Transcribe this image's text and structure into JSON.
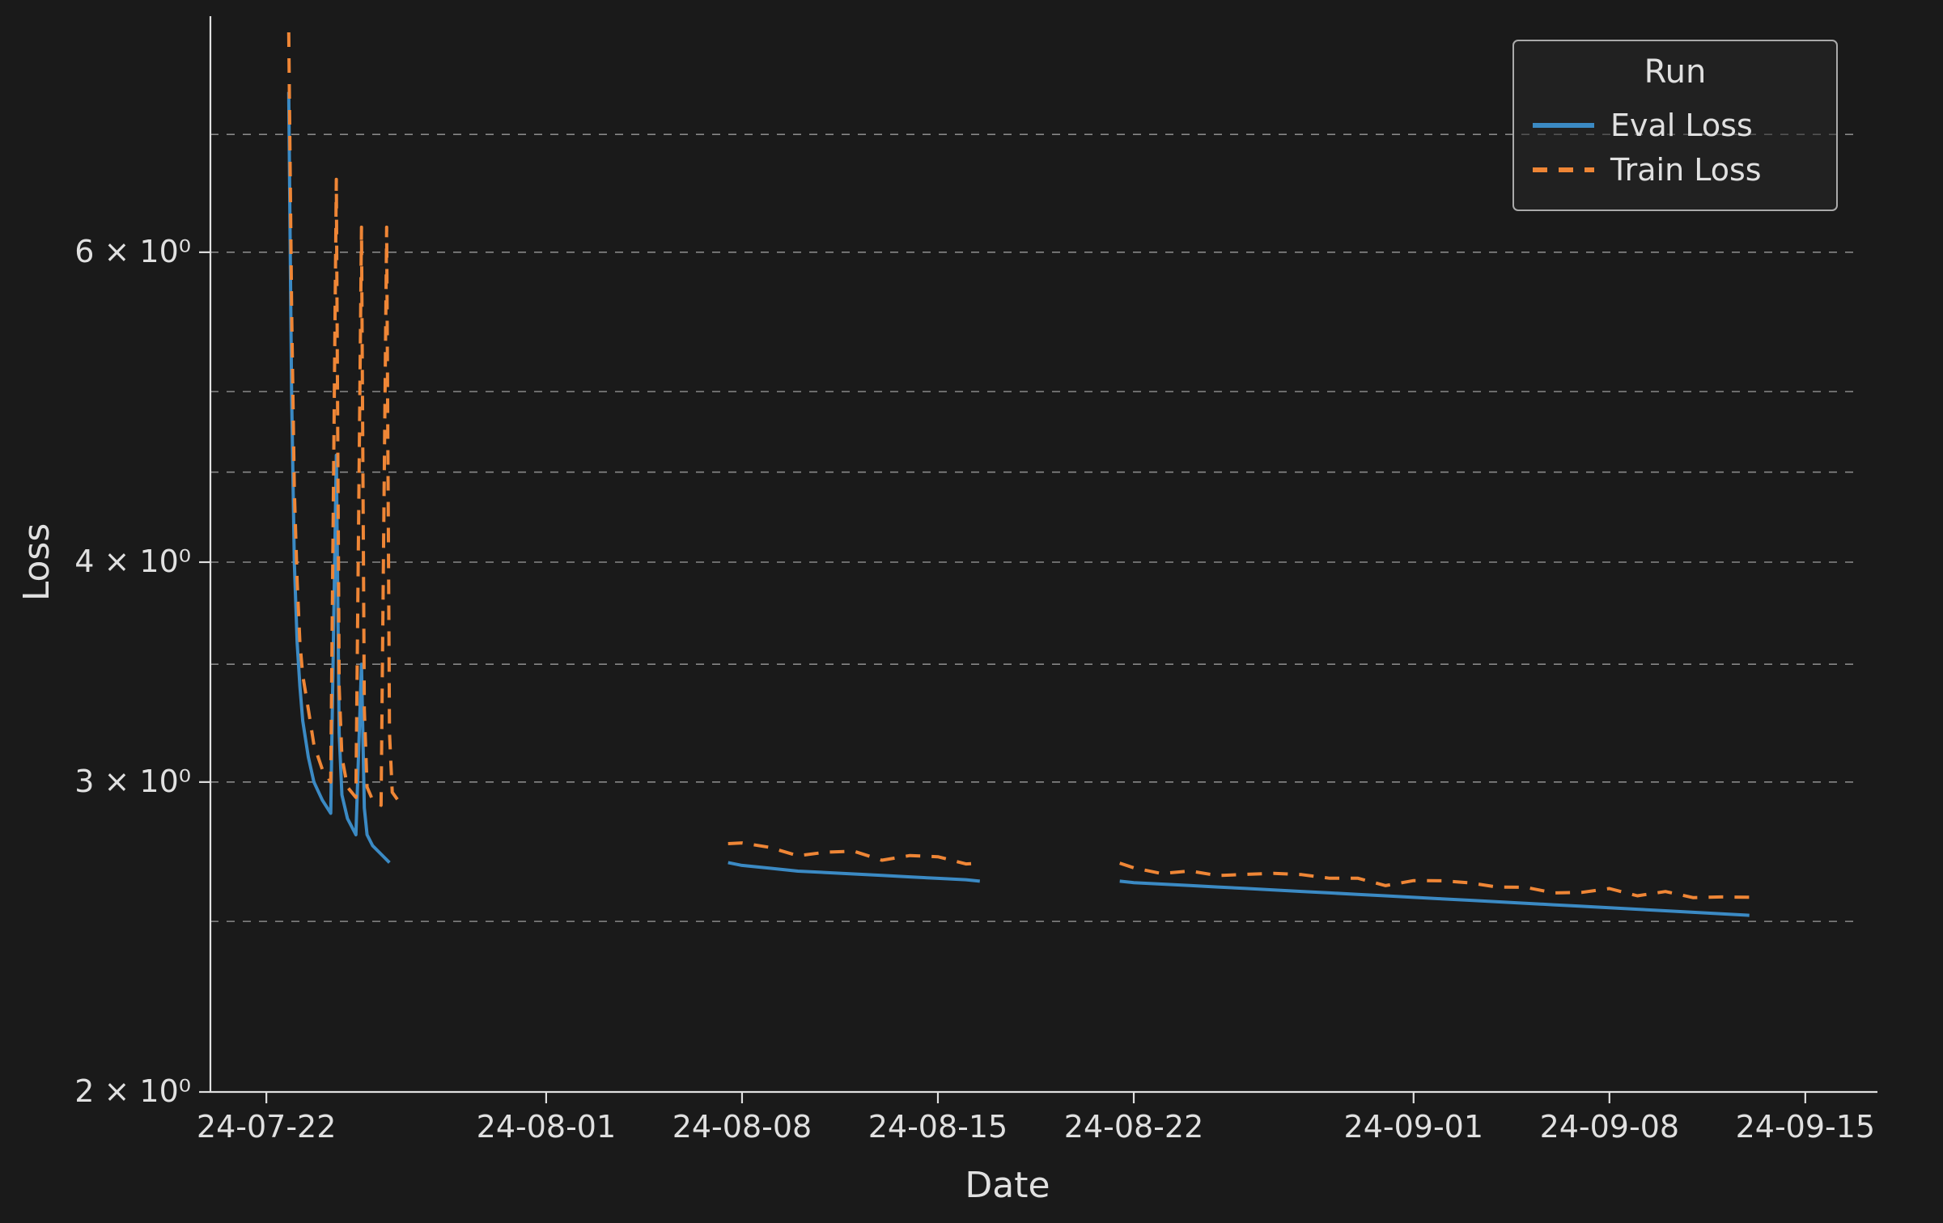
{
  "chart_data": {
    "type": "line",
    "title": "",
    "xlabel": "Date",
    "ylabel": "Loss",
    "yscale": "log",
    "ylim": [
      2.0,
      8.0
    ],
    "xlim": [
      "24-07-20",
      "24-09-17"
    ],
    "x_ticks": [
      "24-07-22",
      "24-08-01",
      "24-08-08",
      "24-08-15",
      "24-08-22",
      "24-09-01",
      "24-09-08",
      "24-09-15"
    ],
    "y_ticks": [
      2,
      3,
      4,
      6
    ],
    "y_tick_labels": [
      "2 × 10⁰",
      "3 × 10⁰",
      "4 × 10⁰",
      "6 × 10⁰"
    ],
    "legend": {
      "title": "Run",
      "position": "upper right",
      "entries": [
        {
          "name": "Eval Loss",
          "color": "#3b8ac4",
          "style": "solid"
        },
        {
          "name": "Train Loss",
          "color": "#ef8636",
          "style": "dashed"
        }
      ]
    },
    "series": [
      {
        "name": "Eval Loss",
        "color": "#3b8ac4",
        "style": "solid",
        "segments": [
          {
            "x": [
              "24-07-22.8",
              "24-07-22.9",
              "24-07-23.0",
              "24-07-23.1",
              "24-07-23.2",
              "24-07-23.3",
              "24-07-23.5",
              "24-07-23.7",
              "24-07-24.0",
              "24-07-24.3",
              "24-07-24.5",
              "24-07-24.6",
              "24-07-24.7",
              "24-07-24.9",
              "24-07-25.2",
              "24-07-25.4",
              "24-07-25.5",
              "24-07-25.6",
              "24-07-25.8",
              "24-07-26.1",
              "24-07-26.4"
            ],
            "y": [
              7.4,
              5.0,
              4.0,
              3.6,
              3.4,
              3.25,
              3.1,
              3.0,
              2.93,
              2.88,
              4.6,
              3.2,
              2.95,
              2.86,
              2.8,
              3.5,
              2.9,
              2.8,
              2.76,
              2.73,
              2.7
            ]
          },
          {
            "x": [
              "24-08-07.5",
              "24-08-08",
              "24-08-09",
              "24-08-10",
              "24-08-11",
              "24-08-12",
              "24-08-13",
              "24-08-14",
              "24-08-15",
              "24-08-16",
              "24-08-16.5"
            ],
            "y": [
              2.7,
              2.69,
              2.68,
              2.67,
              2.665,
              2.66,
              2.655,
              2.65,
              2.645,
              2.64,
              2.635
            ]
          },
          {
            "x": [
              "24-08-21.5",
              "24-08-22",
              "24-08-23",
              "24-08-24",
              "24-08-25",
              "24-08-26",
              "24-08-27",
              "24-08-28",
              "24-08-29",
              "24-08-30",
              "24-08-31",
              "24-09-01",
              "24-09-02",
              "24-09-03",
              "24-09-04",
              "24-09-05",
              "24-09-06",
              "24-09-07",
              "24-09-08",
              "24-09-09",
              "24-09-10",
              "24-09-11",
              "24-09-12",
              "24-09-13"
            ],
            "y": [
              2.635,
              2.63,
              2.625,
              2.62,
              2.615,
              2.61,
              2.605,
              2.6,
              2.595,
              2.59,
              2.585,
              2.58,
              2.575,
              2.57,
              2.565,
              2.56,
              2.555,
              2.55,
              2.545,
              2.54,
              2.535,
              2.53,
              2.525,
              2.52
            ]
          }
        ]
      },
      {
        "name": "Train Loss",
        "color": "#ef8636",
        "style": "dashed",
        "segments": [
          {
            "x": [
              "24-07-22.8",
              "24-07-22.9",
              "24-07-23.0",
              "24-07-23.1",
              "24-07-23.2",
              "24-07-23.3",
              "24-07-23.5",
              "24-07-23.7",
              "24-07-24.0",
              "24-07-24.3",
              "24-07-24.5",
              "24-07-24.6",
              "24-07-24.7",
              "24-07-24.9",
              "24-07-25.2",
              "24-07-25.4",
              "24-07-25.5",
              "24-07-25.6",
              "24-07-25.8",
              "24-07-26.1",
              "24-07-26.3",
              "24-07-26.4",
              "24-07-26.5",
              "24-07-26.7",
              "24-07-26.9"
            ],
            "y": [
              8.0,
              5.6,
              4.4,
              3.9,
              3.6,
              3.45,
              3.3,
              3.15,
              3.05,
              3.0,
              6.6,
              3.4,
              3.1,
              2.98,
              2.94,
              6.2,
              3.3,
              2.98,
              2.93,
              2.91,
              6.2,
              3.2,
              2.96,
              2.93,
              2.9
            ]
          },
          {
            "x": [
              "24-08-07.5",
              "24-08-08",
              "24-08-09",
              "24-08-10",
              "24-08-11",
              "24-08-12",
              "24-08-13",
              "24-08-14",
              "24-08-15",
              "24-08-16",
              "24-08-16.5"
            ],
            "y": [
              2.77,
              2.76,
              2.745,
              2.74,
              2.735,
              2.73,
              2.72,
              2.715,
              2.71,
              2.705,
              2.7
            ]
          },
          {
            "x": [
              "24-08-21.5",
              "24-08-22",
              "24-08-23",
              "24-08-24",
              "24-08-25",
              "24-08-26",
              "24-08-27",
              "24-08-28",
              "24-08-29",
              "24-08-30",
              "24-08-31",
              "24-09-01",
              "24-09-02",
              "24-09-03",
              "24-09-04",
              "24-09-05",
              "24-09-06",
              "24-09-07",
              "24-09-08",
              "24-09-09",
              "24-09-10",
              "24-09-11",
              "24-09-12",
              "24-09-13"
            ],
            "y": [
              2.685,
              2.68,
              2.675,
              2.67,
              2.665,
              2.66,
              2.655,
              2.65,
              2.645,
              2.64,
              2.635,
              2.63,
              2.625,
              2.62,
              2.615,
              2.61,
              2.605,
              2.6,
              2.595,
              2.59,
              2.585,
              2.58,
              2.575,
              2.57
            ]
          }
        ]
      }
    ]
  }
}
